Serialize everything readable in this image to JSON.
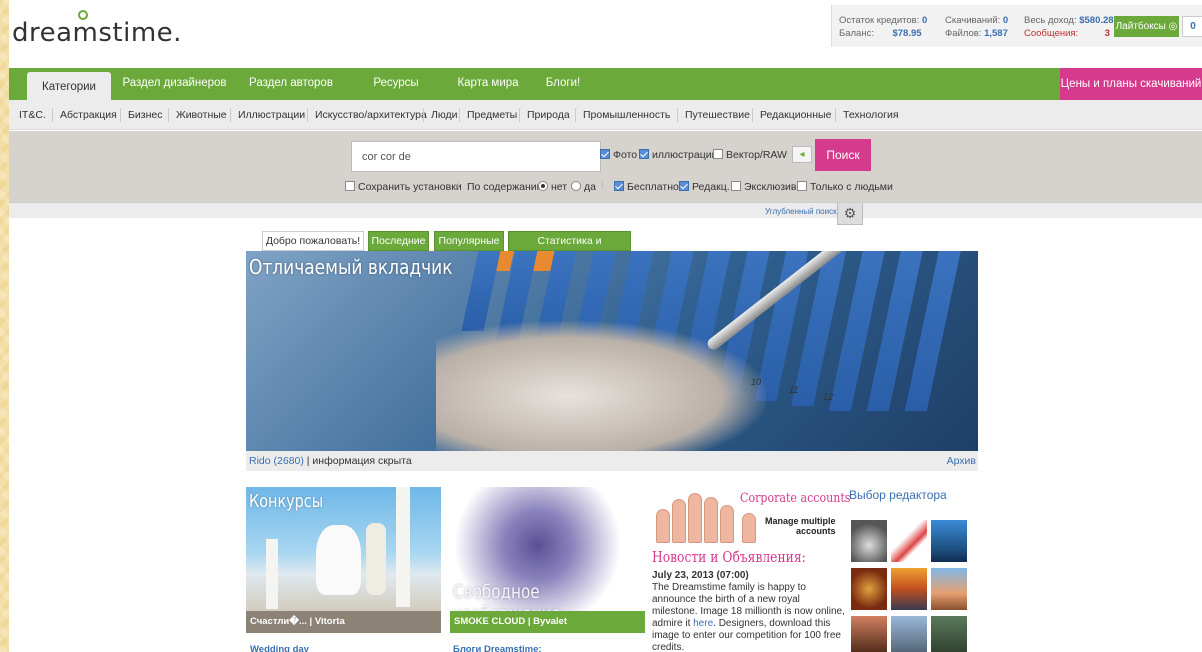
{
  "header": {
    "logo": "dreamstime.",
    "stats": {
      "credits_label": "Остаток кредитов:",
      "credits_value": "0",
      "balance_label": "Баланс:",
      "balance_value": "$78.95",
      "downloads_label": "Скачиваний:",
      "downloads_value": "0",
      "files_label": "Файлов:",
      "files_value": "1,587",
      "earnings_label": "Весь доход:",
      "earnings_value": "$580.28",
      "messages_label": "Сообщения:",
      "messages_value": "3"
    },
    "lightbox_label": "Лайтбоксы",
    "lightbox_count": "0"
  },
  "nav": {
    "tabs": [
      "Категории",
      "Раздел дизайнеров",
      "Раздел авторов",
      "Ресурсы",
      "Карта мира",
      "Блоги!"
    ],
    "pricing": "Цены и планы скачиваний"
  },
  "categories": [
    "IT&C.",
    "Абстракция",
    "Бизнес",
    "Животные",
    "Иллюстрации",
    "Искусство/архитектура",
    "Люди",
    "Предметы",
    "Природа",
    "Промышленность",
    "Путешествие",
    "Редакционные",
    "Технология"
  ],
  "search": {
    "query": "cor cor de",
    "photo_label": "Фото",
    "illustrations_label": "иллюстрации",
    "vector_label": "Вектор/RAW",
    "search_button": "Поиск",
    "save_settings": "Сохранить установки",
    "by_content": "По содержанию",
    "no_label": "нет",
    "yes_label": "да",
    "free_label": "Бесплатно",
    "editorial_label": "Редакц.",
    "exclusive_label": "Эксклюзив",
    "people_only_label": "Только с людьми",
    "advanced_link": "Углубленный поиск"
  },
  "feature_tabs": [
    "Добро пожаловать!",
    "Последние",
    "Популярные",
    "Статистика и сообщество"
  ],
  "hero": {
    "title": "Отличаемый вкладчик",
    "author_link": "Rido (2680)",
    "info": " | информация скрыта",
    "archive": "Архив",
    "axis_numbers": [
      "10",
      "11",
      "12"
    ]
  },
  "panels": {
    "contests_title": "Конкурсы",
    "contests_caption": "Счастли�... | Vitorta",
    "free_title": "Свободное изображение",
    "free_caption": "SMOKE CLOUD | Byvalet",
    "below_left": "Wedding day",
    "below_mid": "Блоги Dreamstime:"
  },
  "corporate": {
    "title": "Corporate accounts",
    "subtitle_1": "Manage multiple",
    "subtitle_2": "accounts"
  },
  "news": {
    "title": "Новости и Объявления:",
    "date": "July 23, 2013 (07:00)",
    "body_1": "The Dreamstime family is happy to announce the birth of a new royal milestone. Image 18 millionth is now online, admire it ",
    "body_link": "here",
    "body_2": ". Designers, download this image to enter our competition for 100 free credits."
  },
  "editors_choice": {
    "title": "Выбор редактора"
  },
  "colors": {
    "green": "#6aa93a",
    "pink": "#d63a8c",
    "link_blue": "#3a6fb0"
  }
}
